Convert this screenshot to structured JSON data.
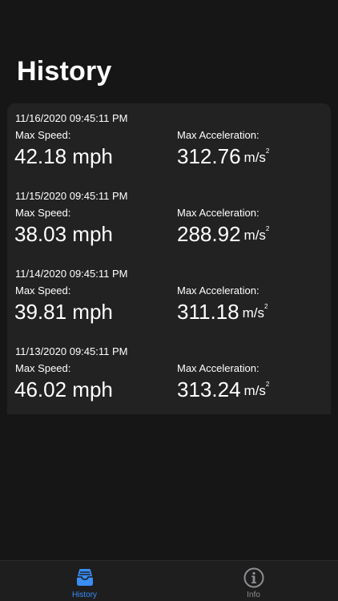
{
  "colors": {
    "background": "#161616",
    "card": "#222222",
    "accent": "#3a8ef6",
    "inactive": "#8e8e93"
  },
  "header": {
    "title": "History"
  },
  "entries": [
    {
      "date": "11/16/2020 09:45:11 PM",
      "speed_label": "Max Speed:",
      "speed_value": "42.18 mph",
      "accel_label": "Max Acceleration:",
      "accel_value": "312.76",
      "accel_unit": "m/s",
      "accel_unit_exp": "2"
    },
    {
      "date": "11/15/2020 09:45:11 PM",
      "speed_label": "Max Speed:",
      "speed_value": "38.03 mph",
      "accel_label": "Max Acceleration:",
      "accel_value": "288.92",
      "accel_unit": "m/s",
      "accel_unit_exp": "2"
    },
    {
      "date": "11/14/2020 09:45:11 PM",
      "speed_label": "Max Speed:",
      "speed_value": "39.81 mph",
      "accel_label": "Max Acceleration:",
      "accel_value": "311.18",
      "accel_unit": "m/s",
      "accel_unit_exp": "2"
    },
    {
      "date": "11/13/2020 09:45:11 PM",
      "speed_label": "Max Speed:",
      "speed_value": "46.02 mph",
      "accel_label": "Max Acceleration:",
      "accel_value": "313.24",
      "accel_unit": "m/s",
      "accel_unit_exp": "2"
    }
  ],
  "tab_bar": {
    "tabs": [
      {
        "label": "History",
        "icon": "tray-icon",
        "selected": true
      },
      {
        "label": "Info",
        "icon": "info-circle-icon",
        "selected": false
      }
    ]
  }
}
